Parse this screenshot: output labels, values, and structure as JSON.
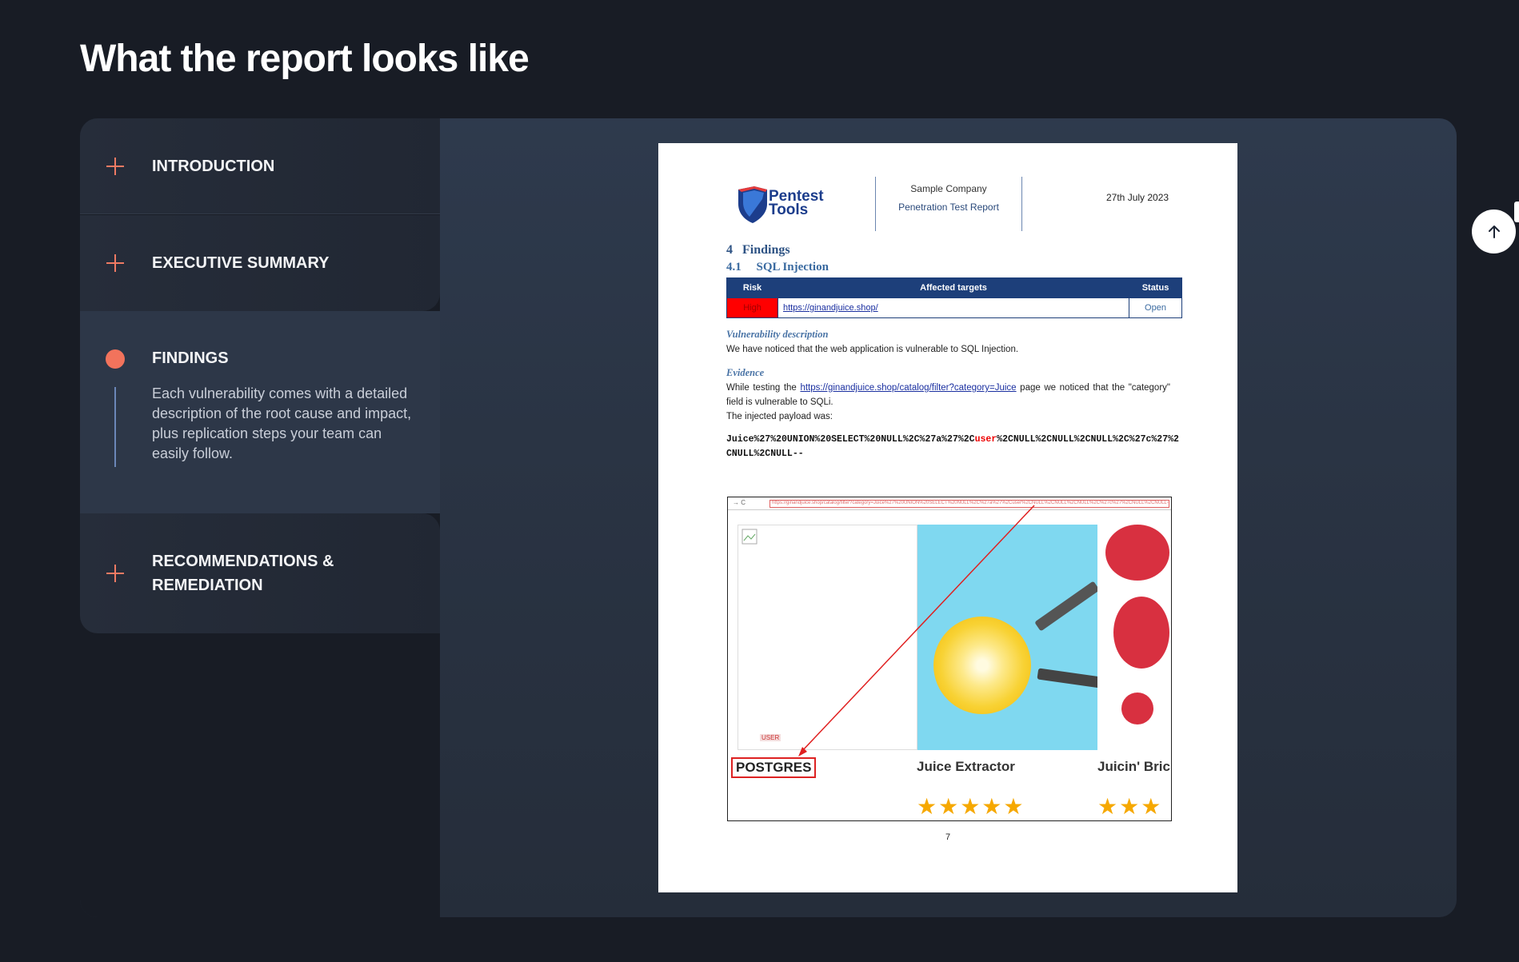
{
  "page": {
    "title": "What the report looks like"
  },
  "accordion": {
    "items": [
      {
        "label": "INTRODUCTION",
        "icon": "plus-icon",
        "expanded": false
      },
      {
        "label": "EXECUTIVE SUMMARY",
        "icon": "plus-icon",
        "expanded": false
      },
      {
        "label": "FINDINGS",
        "icon": "dot-icon",
        "expanded": true,
        "description": "Each vulnerability comes with a detailed description of the root cause and impact, plus replication steps your team can easily follow."
      },
      {
        "label": "RECOMMENDATIONS & REMEDIATION",
        "icon": "plus-icon",
        "expanded": false
      }
    ]
  },
  "report": {
    "logo_text_line1": "Pentest",
    "logo_text_line2": "Tools",
    "company": "Sample Company",
    "report_name": "Penetration Test Report",
    "date": "27th July 2023",
    "section": "4   Findings",
    "subsection": "4.1     SQL Injection",
    "table": {
      "headers": [
        "Risk",
        "Affected targets",
        "Status"
      ],
      "row": {
        "risk": "High",
        "target": "https://ginandjuice.shop/",
        "status": "Open"
      }
    },
    "vuln_heading": "Vulnerability description",
    "vuln_text": "We have noticed that the web application is vulnerable to SQL Injection.",
    "evidence_heading": "Evidence",
    "evidence_pre": "While testing the",
    "evidence_link": "https://ginandjuice.shop/catalog/filter?category=Juice",
    "evidence_post": "page we noticed that the \"category\" field is vulnerable to SQLi.",
    "payload_intro": "The injected payload was:",
    "payload_a": "Juice%27%20UNION%20SELECT%20NULL%2C%27a%27%2C",
    "payload_red": "user",
    "payload_b": "%2CNULL%2CNULL%2CNULL%2C%27c%27%2CNULL%2CNULL--",
    "screenshot": {
      "url": "https://ginandjuice.shop/catalog/filter?category=Juice%27%20UNION%20SELECT%20NULL%2C%27a%27%2Cuser%2CNULL%2CNULL%2CNULL%2C%27c%27%2CNULL%2CNULL--",
      "user_tag": "USER",
      "result_label": "POSTGRES",
      "product_1": "Juice Extractor",
      "product_2": "Juicin' Bric",
      "stars_1": "★★★★★",
      "stars_2": "★★★"
    },
    "page_number": "7"
  },
  "colors": {
    "accent": "#f2735c",
    "panel": "#2e3a4d",
    "background": "#181c25"
  }
}
